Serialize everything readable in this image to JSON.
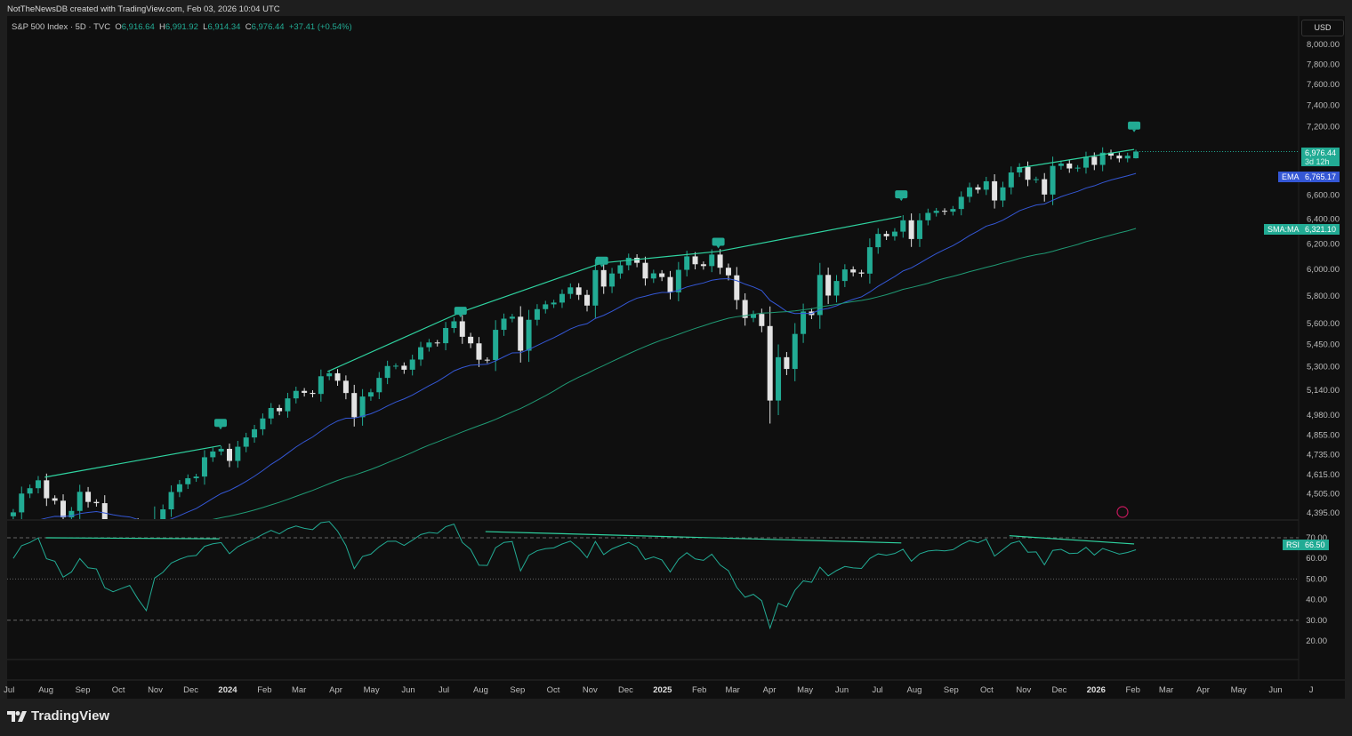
{
  "credit": "NotTheNewsDB created with TradingView.com, Feb 03, 2026 10:04 UTC",
  "legend": {
    "symbol": "S&P 500 Index · 5D · TVC",
    "o_label": "O",
    "o": "6,916.64",
    "h_label": "H",
    "h": "6,991.92",
    "l_label": "L",
    "l": "6,914.34",
    "c_label": "C",
    "c": "6,976.44",
    "change": "+37.41 (+0.54%)"
  },
  "currency": "USD",
  "brand": "TradingView",
  "colors": {
    "up": "#22ab94",
    "down": "#e3e3e3",
    "ema": "#3457d5",
    "sma": "#1f9a74",
    "trend": "#2fd3a0",
    "rsi": "#22ab94",
    "background": "#0f0f0f"
  },
  "price_tags": {
    "last": {
      "value": "6,976.44",
      "countdown": "3d 12h"
    },
    "ema": {
      "label": "EMA",
      "value": "6,765.17"
    },
    "sma": {
      "label": "SMA:MA",
      "value": "6,321.10"
    },
    "rsi": {
      "label": "RSI",
      "value": "66.50"
    }
  },
  "chart_data": {
    "type": "candlestick",
    "scale": "log",
    "ylim": [
      4395,
      8000
    ],
    "y_ticks": [
      "8,000.00",
      "7,800.00",
      "7,600.00",
      "7,400.00",
      "7,200.00",
      "6,600.00",
      "6,400.00",
      "6,200.00",
      "6,000.00",
      "5,800.00",
      "5,600.00",
      "5,450.00",
      "5,300.00",
      "5,140.00",
      "4,980.00",
      "4,855.00",
      "4,735.00",
      "4,615.00",
      "4,505.00",
      "4,395.00"
    ],
    "x_ticks": [
      "Jul",
      "Aug",
      "Sep",
      "Oct",
      "Nov",
      "Dec",
      "2024",
      "Feb",
      "Mar",
      "Apr",
      "May",
      "Jun",
      "Jul",
      "Aug",
      "Sep",
      "Oct",
      "Nov",
      "Dec",
      "2025",
      "Feb",
      "Mar",
      "Apr",
      "May",
      "Jun",
      "Jul",
      "Aug",
      "Sep",
      "Oct",
      "Nov",
      "Dec",
      "2026",
      "Feb",
      "Mar",
      "Apr",
      "May",
      "Jun",
      "J"
    ],
    "x_tick_start": "2023-07-01",
    "first_week": "2023-07-03",
    "weekly_close": [
      4398,
      4505,
      4536,
      4582,
      4478,
      4464,
      4370,
      4406,
      4515,
      4457,
      4450,
      4320,
      4288,
      4308,
      4327,
      4224,
      4117,
      4358,
      4415,
      4514,
      4559,
      4594,
      4604,
      4719,
      4754,
      4770,
      4697,
      4783,
      4840,
      4891,
      4959,
      5026,
      5005,
      5088,
      5137,
      5124,
      5117,
      5234,
      5254,
      5204,
      5123,
      4967,
      5100,
      5128,
      5223,
      5303,
      5305,
      5278,
      5347,
      5432,
      5465,
      5460,
      5567,
      5615,
      5505,
      5459,
      5346,
      5344,
      5554,
      5634,
      5648,
      5408,
      5626,
      5703,
      5738,
      5751,
      5815,
      5864,
      5808,
      5729,
      5995,
      5870,
      5969,
      6032,
      6090,
      6051,
      5931,
      5970,
      5942,
      5827,
      5997,
      6101,
      6040,
      6026,
      6115,
      6013,
      5955,
      5770,
      5639,
      5668,
      5581,
      5074,
      5363,
      5283,
      5525,
      5686,
      5660,
      5958,
      5803,
      5912,
      6000,
      5977,
      5968,
      6173,
      6279,
      6260,
      6297,
      6389,
      6238,
      6389,
      6450,
      6467,
      6460,
      6482,
      6584,
      6664,
      6644,
      6716,
      6553,
      6664,
      6792,
      6840,
      6729,
      6734,
      6603,
      6849,
      6870,
      6827,
      6834,
      6930,
      6858,
      6966,
      6940,
      6915,
      6939,
      6976.44
    ],
    "last_candle": {
      "open": 6916.64,
      "high": 6991.92,
      "low": 6914.34,
      "close": 6976.44
    },
    "indicators": {
      "ema_value": 6765.17,
      "sma_value": 6321.1,
      "rsi_value": 66.5
    },
    "trendlines": [
      [
        [
          "2023-07-31",
          4600
        ],
        [
          "2023-12-26",
          4790
        ]
      ],
      [
        [
          "2024-03-25",
          5265
        ],
        [
          "2024-07-15",
          5680
        ],
        [
          "2024-11-11",
          6050
        ],
        [
          "2025-02-17",
          6140
        ],
        [
          "2025-07-21",
          6420
        ]
      ],
      [
        [
          "2025-10-27",
          6830
        ],
        [
          "2026-02-02",
          6995
        ]
      ]
    ],
    "signal_dates": [
      "2023-12-26",
      "2024-07-15",
      "2024-11-11",
      "2025-02-17",
      "2025-07-21",
      "2026-02-02"
    ],
    "rsi": {
      "y_ticks": [
        "70.00",
        "60.00",
        "50.00",
        "40.00",
        "30.00",
        "20.00"
      ],
      "levels": [
        70,
        50,
        30
      ],
      "trendlines": [
        [
          [
            "2023-08-01",
            70
          ],
          [
            "2023-12-25",
            69.5
          ]
        ],
        [
          [
            "2024-08-05",
            73
          ],
          [
            "2025-07-21",
            67.5
          ]
        ],
        [
          [
            "2025-10-20",
            71
          ],
          [
            "2026-02-02",
            67
          ]
        ]
      ]
    }
  }
}
